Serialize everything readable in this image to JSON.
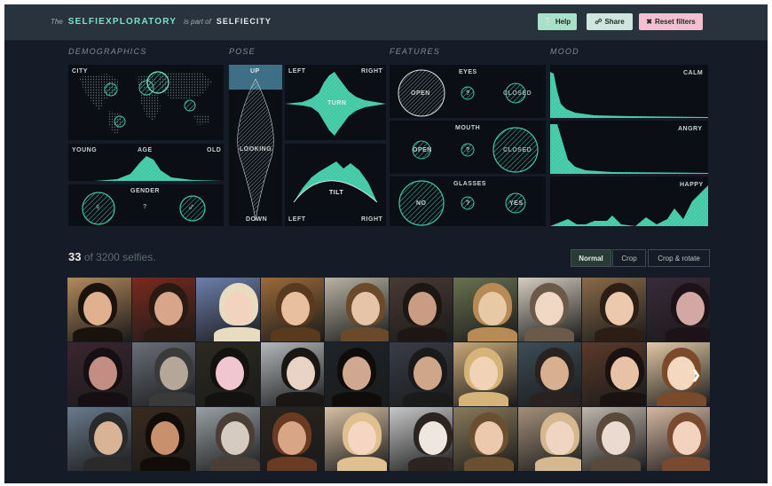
{
  "header": {
    "pre": "The",
    "name": "SELFIEXPLORATORY",
    "mid": "is part of",
    "city": "SELFIECITY",
    "help_label": "Help",
    "share_label": "Share",
    "reset_label": "Reset filters",
    "help_icon": "question-circle-icon",
    "share_icon": "share-icon",
    "reset_icon": "close-icon"
  },
  "sections": {
    "demographics": "DEMOGRAPHICS",
    "pose": "POSE",
    "features": "FEATURES",
    "mood": "MOOD"
  },
  "demographics": {
    "city_label": "CITY",
    "age_label": "AGE",
    "age_young": "YOUNG",
    "age_old": "OLD",
    "gender_label": "GENDER",
    "gender_unknown": "?",
    "female_icon": "female-symbol-icon",
    "male_icon": "male-symbol-icon"
  },
  "pose": {
    "up": "UP",
    "looking": "LOOKING",
    "down": "DOWN",
    "turn_left": "LEFT",
    "turn_right": "RIGHT",
    "turn_label": "TURN",
    "tilt_label": "TILT",
    "tilt_left": "LEFT",
    "tilt_right": "RIGHT"
  },
  "features": {
    "eyes": {
      "label": "EYES",
      "open": "OPEN",
      "unknown": "?",
      "closed": "CLOSED"
    },
    "mouth": {
      "label": "MOUTH",
      "open": "OPEN",
      "unknown": "?",
      "closed": "CLOSED"
    },
    "glasses": {
      "label": "GLASSES",
      "no": "NO",
      "unknown": "?",
      "yes": "YES"
    }
  },
  "mood": {
    "calm": "CALM",
    "angry": "ANGRY",
    "happy": "HAPPY"
  },
  "results": {
    "count": "33",
    "suffix": "of 3200 selfies."
  },
  "view_modes": {
    "normal": "Normal",
    "crop": "Crop",
    "crop_rotate": "Crop & rotate",
    "selected": "Normal"
  },
  "grid": {
    "next_icon": "chevron-right-icon",
    "tiles": [
      {
        "bg": "#b38a5e",
        "face": "#e0b08f",
        "hair": "#1a120d"
      },
      {
        "bg": "#7a2a1e",
        "face": "#d8a48a",
        "hair": "#2a1a14"
      },
      {
        "bg": "#6d7fae",
        "face": "#f1d3c0",
        "hair": "#e7dcc0"
      },
      {
        "bg": "#9c6a3a",
        "face": "#e8c0a0",
        "hair": "#5a3a1f"
      },
      {
        "bg": "#b9b3a3",
        "face": "#e6c4a8",
        "hair": "#6a4a2a"
      },
      {
        "bg": "#4a3a34",
        "face": "#c99c84",
        "hair": "#1e1612"
      },
      {
        "bg": "#6a7150",
        "face": "#e7c9a5",
        "hair": "#b88a56"
      },
      {
        "bg": "#d5cdbf",
        "face": "#f0d8c4",
        "hair": "#6b5a4a"
      },
      {
        "bg": "#8a6a4a",
        "face": "#ecc9ad",
        "hair": "#2c1e14"
      },
      {
        "bg": "#3a2a3a",
        "face": "#d3a7a3",
        "hair": "#1c1218"
      },
      {
        "bg": "#3c2530",
        "face": "#c48d84",
        "hair": "#150e12"
      },
      {
        "bg": "#6a6f7a",
        "face": "#b4a79a",
        "hair": "#3a3a3a"
      },
      {
        "bg": "#2c2a20",
        "face": "#f0c6d0",
        "hair": "#141210"
      },
      {
        "bg": "#b4b8bc",
        "face": "#e9d3c4",
        "hair": "#1a1614"
      },
      {
        "bg": "#1e242a",
        "face": "#d0a890",
        "hair": "#0f0c0a"
      },
      {
        "bg": "#3a3d48",
        "face": "#cfa68a",
        "hair": "#1a1a1a"
      },
      {
        "bg": "#c9a779",
        "face": "#f2d2b6",
        "hair": "#d6b479"
      },
      {
        "bg": "#3e4d58",
        "face": "#d9b08f",
        "hair": "#2a2220"
      },
      {
        "bg": "#5c3a2a",
        "face": "#e8c2a6",
        "hair": "#1a1210"
      },
      {
        "bg": "#e2c8a4",
        "face": "#f5d8c0",
        "hair": "#7a4a2a"
      },
      {
        "bg": "#6a7a8c",
        "face": "#d8b396",
        "hair": "#2a2a2a"
      },
      {
        "bg": "#3a2a1e",
        "face": "#c8906c",
        "hair": "#120c08"
      },
      {
        "bg": "#9aa0a4",
        "face": "#d6cbc0",
        "hair": "#4a3e36"
      },
      {
        "bg": "#2a241e",
        "face": "#d8a586",
        "hair": "#6a3a22"
      },
      {
        "bg": "#d7bfa4",
        "face": "#f4d6c2",
        "hair": "#e0c08e"
      },
      {
        "bg": "#c8c8c8",
        "face": "#efe6e0",
        "hair": "#2c2420"
      },
      {
        "bg": "#8a7a5a",
        "face": "#ecc9ac",
        "hair": "#6a5030"
      },
      {
        "bg": "#a4907a",
        "face": "#f0d6c0",
        "hair": "#d6b890"
      },
      {
        "bg": "#c0b6ac",
        "face": "#eadad0",
        "hair": "#5a4a3e"
      },
      {
        "bg": "#d6b8a2",
        "face": "#f4d2c0",
        "hair": "#7a4a30"
      }
    ]
  }
}
